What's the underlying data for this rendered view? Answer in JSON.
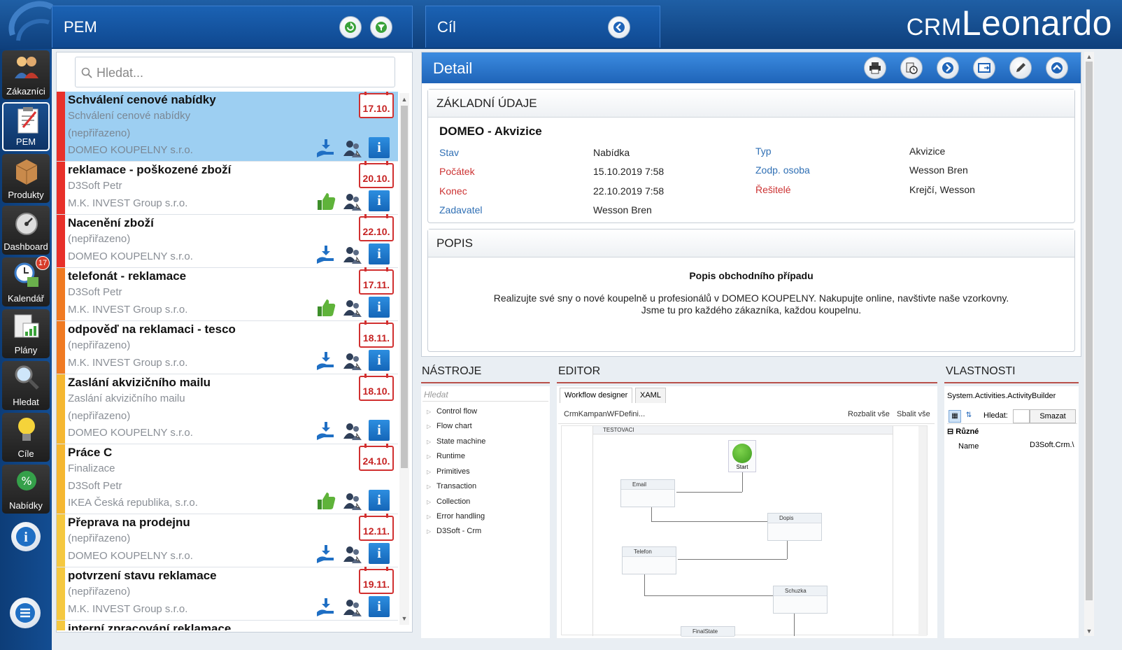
{
  "brand": {
    "prefix": "CRM",
    "name": "Leonardo"
  },
  "pem_header": {
    "title": "PEM"
  },
  "cil_header": {
    "title": "Cíl"
  },
  "sidebar": {
    "items": [
      {
        "label": "Zákazníci",
        "icon": "customers-icon"
      },
      {
        "label": "PEM",
        "icon": "clipboard-icon"
      },
      {
        "label": "Produkty",
        "icon": "box-icon"
      },
      {
        "label": "Dashboard",
        "icon": "gauge-icon"
      },
      {
        "label": "Kalendář",
        "icon": "calendar-clock-icon",
        "badge": "17"
      },
      {
        "label": "Plány",
        "icon": "chart-icon"
      },
      {
        "label": "Hledat",
        "icon": "magnifier-icon"
      },
      {
        "label": "Cíle",
        "icon": "lightbulb-icon"
      },
      {
        "label": "Nabídky",
        "icon": "percent-icon"
      }
    ]
  },
  "search": {
    "placeholder": "Hledat..."
  },
  "tasks": [
    {
      "title": "Schválení cenové nabídky",
      "lines": [
        "Schválení cenové nabídky",
        "(nepřiřazeno)",
        "DOMEO KOUPELNY s.r.o."
      ],
      "date": "17.10.",
      "color": "#e8302a",
      "status": "download",
      "selected": true
    },
    {
      "title": "reklamace - poškozené zboží",
      "lines": [
        "D3Soft Petr",
        "M.K. INVEST Group s.r.o."
      ],
      "date": "20.10.",
      "color": "#e8302a",
      "status": "thumb"
    },
    {
      "title": "Nacenění zboží",
      "lines": [
        "(nepřiřazeno)",
        "DOMEO KOUPELNY s.r.o."
      ],
      "date": "22.10.",
      "color": "#e8302a",
      "status": "download"
    },
    {
      "title": "telefonát - reklamace",
      "lines": [
        "D3Soft Petr",
        "M.K. INVEST Group s.r.o."
      ],
      "date": "17.11.",
      "color": "#f07a22",
      "status": "thumb"
    },
    {
      "title": "odpověď na reklamaci - tesco",
      "lines": [
        "(nepřiřazeno)",
        "M.K. INVEST Group s.r.o."
      ],
      "date": "18.11.",
      "color": "#f07a22",
      "status": "download"
    },
    {
      "title": "Zaslání akvizičního mailu",
      "lines": [
        "Zaslání akvizičního mailu",
        "(nepřiřazeno)",
        "DOMEO KOUPELNY s.r.o."
      ],
      "date": "18.10.",
      "color": "#f5b731",
      "status": "download"
    },
    {
      "title": "Práce C",
      "lines": [
        "Finalizace",
        "D3Soft Petr",
        "IKEA Česká republika, s.r.o."
      ],
      "date": "24.10.",
      "color": "#f5b731",
      "status": "thumb"
    },
    {
      "title": "Přeprava na prodejnu",
      "lines": [
        "(nepřiřazeno)",
        "DOMEO KOUPELNY s.r.o."
      ],
      "date": "12.11.",
      "color": "#f5c840",
      "status": "download"
    },
    {
      "title": "potvrzení stavu reklamace",
      "lines": [
        "(nepřiřazeno)",
        "M.K. INVEST Group s.r.o."
      ],
      "date": "19.11.",
      "color": "#f5c840",
      "status": "download"
    },
    {
      "title": "interní zpracování reklamace",
      "lines": [],
      "date": "",
      "color": "#f5c840",
      "status": ""
    }
  ],
  "detail": {
    "title": "Detail",
    "basic": {
      "header": "ZÁKLADNÍ ÚDAJE",
      "name": "DOMEO - Akvizice",
      "fields": [
        {
          "label": "Stav",
          "value": "Nabídka",
          "red": false
        },
        {
          "label": "Počátek",
          "value": "15.10.2019 7:58",
          "red": true
        },
        {
          "label": "Konec",
          "value": "22.10.2019 7:58",
          "red": true
        },
        {
          "label": "Zadavatel",
          "value": "Wesson Bren",
          "red": false
        },
        {
          "label": "Typ",
          "value": "Akvizice",
          "red": false
        },
        {
          "label": "Zodp. osoba",
          "value": "Wesson Bren",
          "red": false
        },
        {
          "label": "Řešitelé",
          "value": "Krejčí, Wesson",
          "red": true
        }
      ]
    },
    "popis": {
      "header": "POPIS",
      "title": "Popis obchodního případu",
      "line1": "Realizujte své sny o nové koupelně u profesionálů v DOMEO KOUPELNY. Nakupujte online, navštivte naše vzorkovny.",
      "line2": "Jsme tu pro každého zákazníka, každou koupelnu."
    }
  },
  "tools": {
    "header": "NÁSTROJE",
    "search_placeholder": "Hledat",
    "items": [
      "Control flow",
      "Flow chart",
      "State machine",
      "Runtime",
      "Primitives",
      "Transaction",
      "Collection",
      "Error handling",
      "D3Soft - Crm"
    ]
  },
  "editor": {
    "header": "EDITOR",
    "tabs": [
      "Workflow designer",
      "XAML"
    ],
    "path": "CrmKampanWFDefini...",
    "expand": "Rozbalit vše",
    "collapse": "Sbalit vše",
    "container": "TESTOVACI",
    "nodes": {
      "start": "Start",
      "email": "Email",
      "dopis": "Dopis",
      "telefon": "Telefon",
      "schuzka": "Schuzka",
      "final": "FinalState"
    }
  },
  "props": {
    "header": "VLASTNOSTI",
    "type": "System.Activities.ActivityBuilder",
    "search_label": "Hledat:",
    "clear_label": "Smazat",
    "category": "Různé",
    "row_name": "Name",
    "row_value": "D3Soft.Crm.\\"
  },
  "colors": {
    "accent": "#1f64b8",
    "selected": "#9dcff2",
    "danger": "#c62323"
  }
}
